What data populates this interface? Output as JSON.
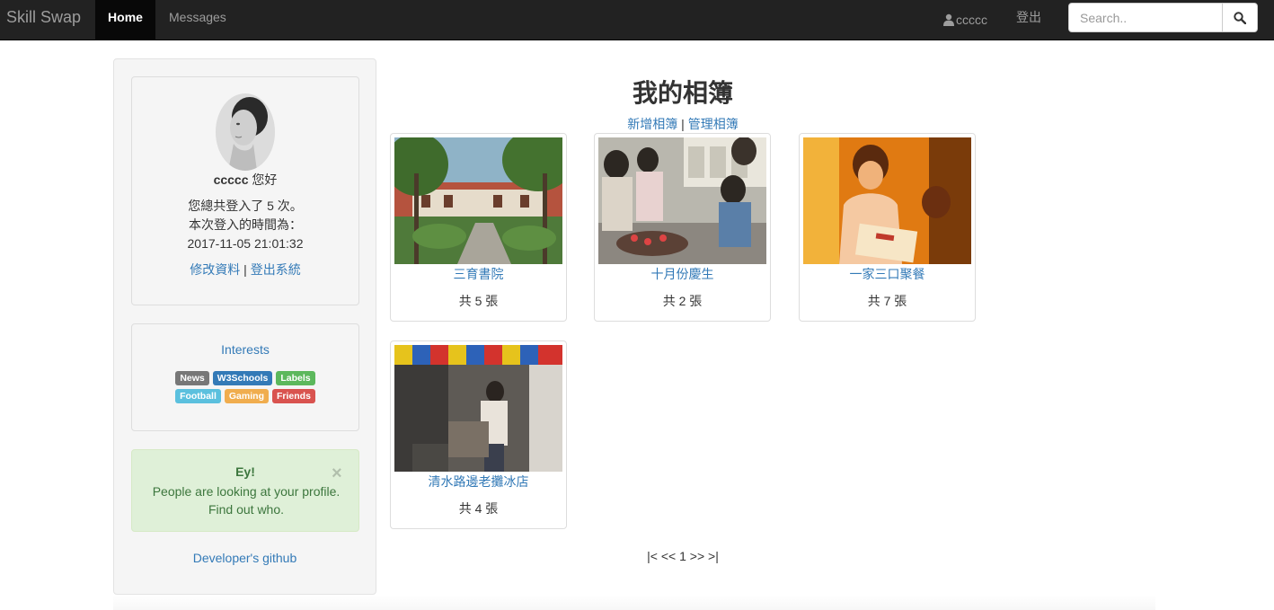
{
  "navbar": {
    "brand": "Skill Swap",
    "home_label": "Home",
    "messages_label": "Messages",
    "user_label": "ccccc",
    "logout_label": "登出",
    "search_placeholder": "Search.."
  },
  "profile": {
    "username": "ccccc",
    "greeting_suffix": " 您好",
    "login_count_text": "您總共登入了 5 次。",
    "login_time_label": "本次登入的時間為：",
    "login_time": "2017-11-05 21:01:32",
    "edit_link": "修改資料",
    "separator": "|",
    "logout_link": "登出系統"
  },
  "interests": {
    "title": "Interests",
    "labels_row1": [
      {
        "text": "News",
        "color": "#777777"
      },
      {
        "text": "W3Schools",
        "color": "#337ab7"
      },
      {
        "text": "Labels",
        "color": "#5cb85c"
      }
    ],
    "labels_row2": [
      {
        "text": "Football",
        "color": "#5bc0de"
      },
      {
        "text": "Gaming",
        "color": "#f0ad4e"
      },
      {
        "text": "Friends",
        "color": "#d9534f"
      }
    ]
  },
  "alert": {
    "title": "Ey!",
    "body": "People are looking at your profile. Find out who.",
    "close": "×"
  },
  "developer_link": "Developer's github",
  "main": {
    "title": "我的相簿",
    "add_album": "新增相簿",
    "separator": "|",
    "manage_album": "管理相簿",
    "albums": [
      {
        "name": "三育書院",
        "count": "共 5 張"
      },
      {
        "name": "十月份慶生",
        "count": "共 2 張"
      },
      {
        "name": "一家三口聚餐",
        "count": "共 7 張"
      },
      {
        "name": "清水路邊老攤冰店",
        "count": "共 4 張"
      }
    ],
    "pager": "|< << 1 >> >|"
  }
}
